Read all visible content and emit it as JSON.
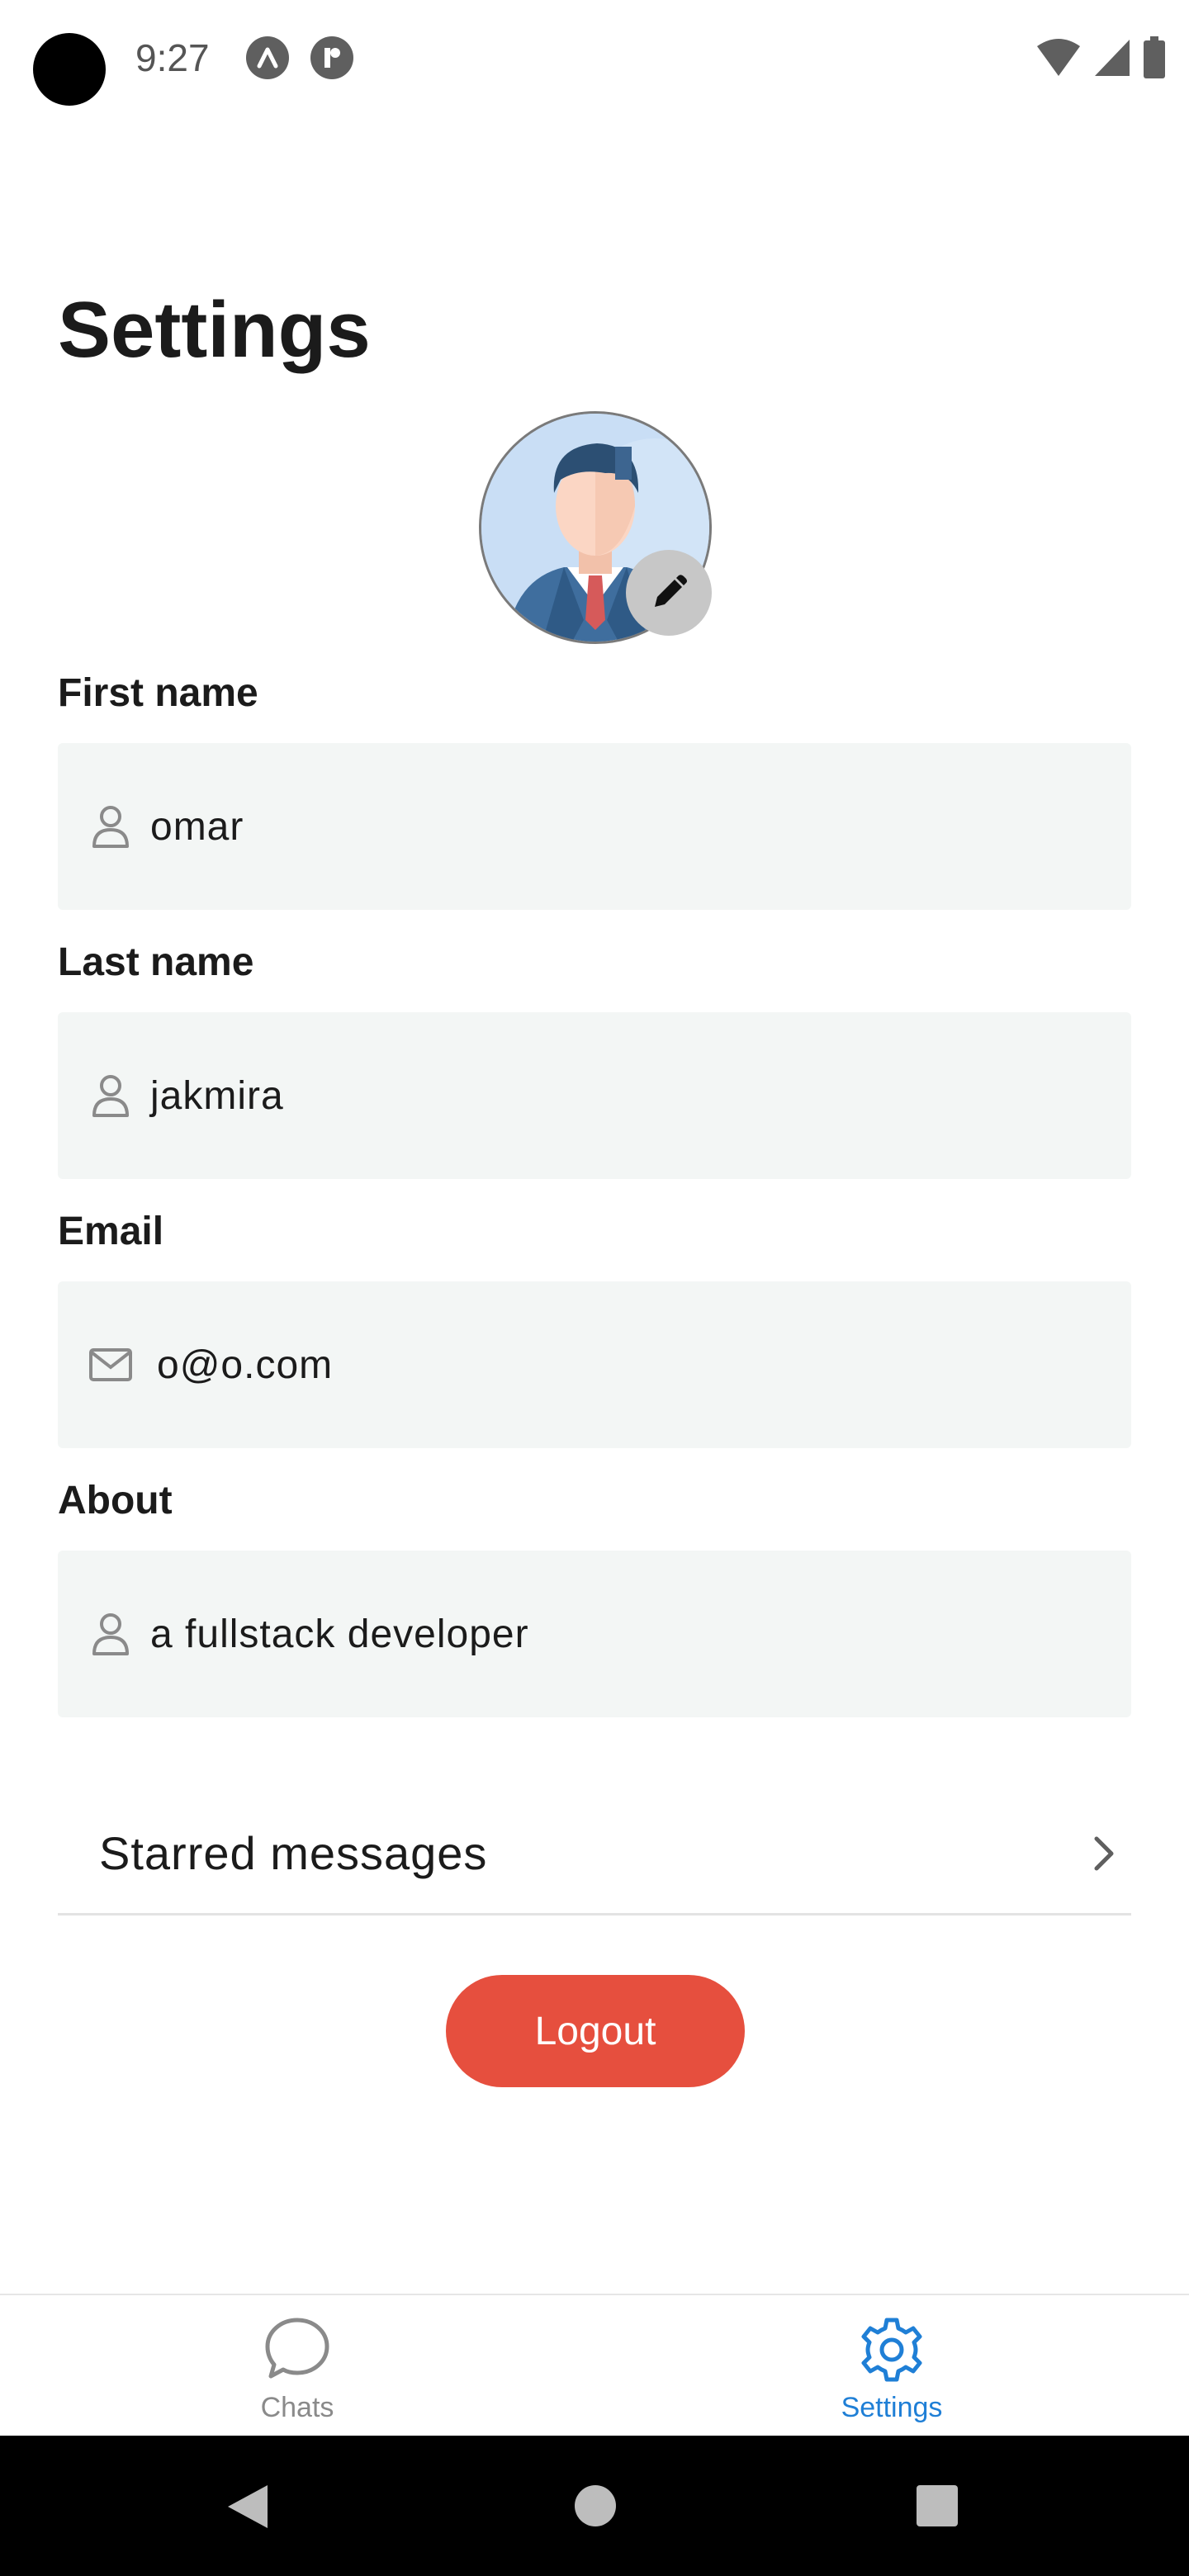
{
  "status_bar": {
    "time": "9:27",
    "icons": [
      "camera-cutout-icon",
      "app-notification-icon",
      "app-notification-icon",
      "wifi-icon",
      "cellular-signal-icon",
      "battery-icon"
    ]
  },
  "page": {
    "title": "Settings"
  },
  "profile": {
    "avatar": "businessman-avatar",
    "edit_icon": "pencil-icon",
    "fields": [
      {
        "label": "First name",
        "value": "omar",
        "icon": "user-icon"
      },
      {
        "label": "Last name",
        "value": "jakmira",
        "icon": "user-icon"
      },
      {
        "label": "Email",
        "value": "o@o.com",
        "icon": "mail-icon"
      },
      {
        "label": "About",
        "value": "a fullstack developer",
        "icon": "user-icon"
      }
    ]
  },
  "starred": {
    "label": "Starred messages",
    "icon": "chevron-right-icon"
  },
  "logout": {
    "label": "Logout",
    "color": "#e64f3e"
  },
  "tabs": [
    {
      "label": "Chats",
      "icon": "chat-bubble-icon",
      "active": false,
      "color": "#8a8a8a"
    },
    {
      "label": "Settings",
      "icon": "gear-icon",
      "active": true,
      "color": "#1f7fd6"
    }
  ]
}
